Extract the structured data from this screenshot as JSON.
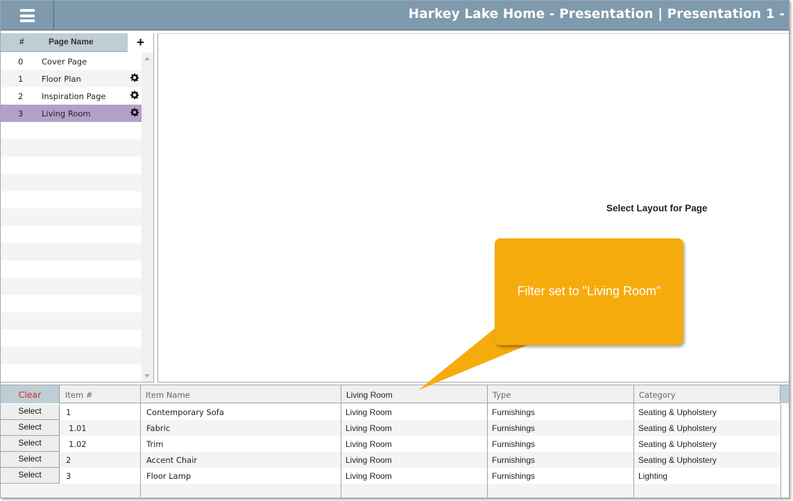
{
  "header": {
    "title": "Harkey Lake Home - Presentation | Presentation 1 -",
    "menu_icon": "hamburger-menu-icon"
  },
  "pages_panel": {
    "col_num": "#",
    "col_name": "Page Name",
    "add_label": "+",
    "pages": [
      {
        "num": "0",
        "name": "Cover Page",
        "has_settings": false,
        "selected": false
      },
      {
        "num": "1",
        "name": "Floor Plan",
        "has_settings": true,
        "selected": false
      },
      {
        "num": "2",
        "name": "Inspiration Page",
        "has_settings": true,
        "selected": false
      },
      {
        "num": "3",
        "name": "Living Room",
        "has_settings": true,
        "selected": true
      }
    ]
  },
  "canvas": {
    "prompt": "Select Layout for Page"
  },
  "callout": {
    "text": "Filter set to \"Living Room\"",
    "color": "#f6ab0d"
  },
  "grid": {
    "clear_label": "Clear",
    "columns": [
      "Item #",
      "Item Name",
      "Living Room",
      "Type",
      "Category"
    ],
    "select_label": "Select",
    "rows": [
      {
        "item_num": "1",
        "item_name": "Contemporary Sofa",
        "room": "Living Room",
        "type": "Furnishings",
        "category": "Seating & Upholstery"
      },
      {
        "item_num": "1.01",
        "item_name": "Fabric",
        "room": "Living Room",
        "type": "Furnishings",
        "category": "Seating & Upholstery"
      },
      {
        "item_num": "1.02",
        "item_name": "Trim",
        "room": "Living Room",
        "type": "Furnishings",
        "category": "Seating & Upholstery"
      },
      {
        "item_num": "2",
        "item_name": "Accent Chair",
        "room": "Living Room",
        "type": "Furnishings",
        "category": "Seating & Upholstery"
      },
      {
        "item_num": "3",
        "item_name": "Floor Lamp",
        "room": "Living Room",
        "type": "Furnishings",
        "category": "Lighting"
      }
    ]
  },
  "colors": {
    "header_bg": "#7f9aad",
    "selected_row": "#b3a0c9",
    "clear_text": "#d9232a",
    "panel_header": "#bfcdd4"
  }
}
